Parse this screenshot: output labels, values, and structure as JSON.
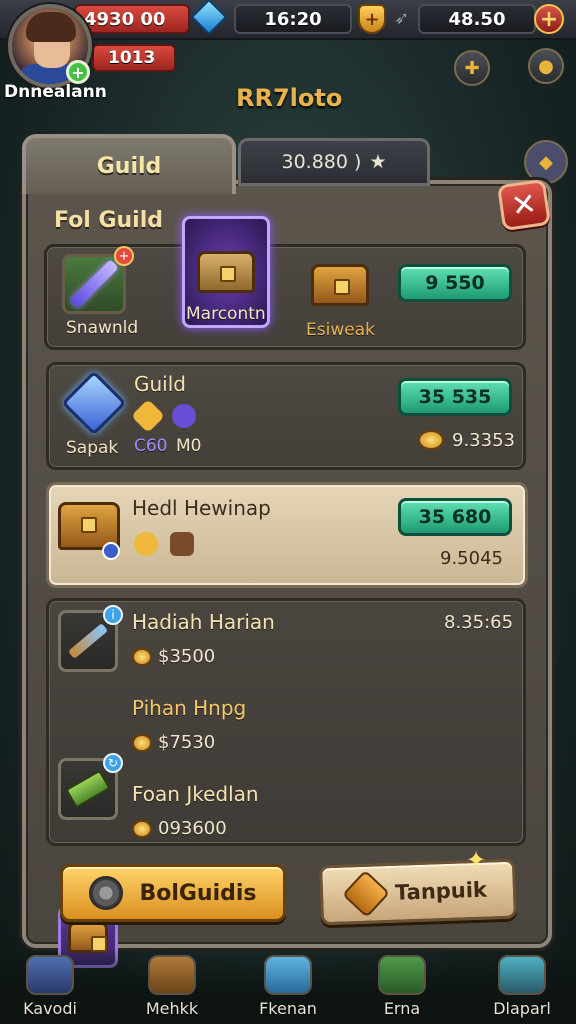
{
  "hud": {
    "currency_1": "4930 00",
    "time": "16:20",
    "currency_2": "48.50",
    "level_value": "1013",
    "player_name": "Dnnealann",
    "region_title": "RR7loto"
  },
  "tabs": {
    "active_label": "Guild",
    "inactive_value": "30.880 )"
  },
  "panel": {
    "section_title": "Fol Guild",
    "featured_items": [
      {
        "label": "Snawnld"
      },
      {
        "label": "Marcontn"
      },
      {
        "label": "Esiweak"
      }
    ],
    "featured_price": "9 550",
    "rows": [
      {
        "icon_label": "Sapak",
        "title": "Guild",
        "sub_1": "C60",
        "sub_2": "M0",
        "price": "35 535",
        "value": "9.3353"
      },
      {
        "title": "Hedl Hewinap",
        "price": "35 680",
        "value": "9.5045"
      }
    ],
    "list": [
      {
        "title": "Hadiah Harian",
        "amount": "$3500",
        "right_value": "8.35:65"
      },
      {
        "title": "Pihan Hnpg",
        "amount": "$7530"
      },
      {
        "title": "Foan Jkedlan",
        "amount": "093600"
      }
    ],
    "btn_primary": "BolGuidis",
    "btn_secondary": "Tanpuik"
  },
  "nav": {
    "items": [
      "Kavodi",
      "Mehkk",
      "Fkenan",
      "Erna",
      "Dlaparl"
    ]
  },
  "colors": {
    "accent_gold": "#e9b24a",
    "price_green": "#1f9a74",
    "close_red": "#d84a3e"
  },
  "icons": [
    "gem-icon",
    "shield-icon",
    "plus-icon",
    "star-icon",
    "close-icon",
    "sword-icon",
    "chest-icon",
    "crystal-icon",
    "coin-icon",
    "gear-icon",
    "heart-shield-icon",
    "sparkle-icon"
  ]
}
